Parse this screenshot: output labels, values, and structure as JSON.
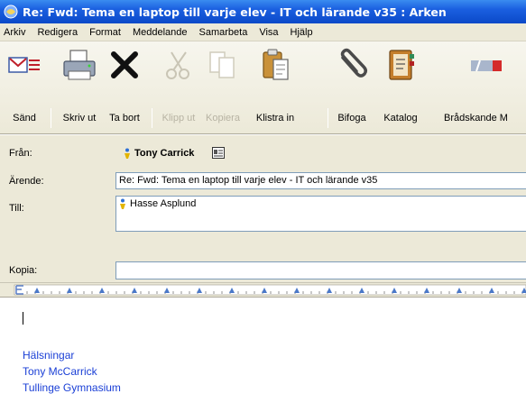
{
  "window": {
    "title": "Re: Fwd: Tema en laptop till varje elev -  IT och lärande v35 : Arken"
  },
  "menu": [
    "Arkiv",
    "Redigera",
    "Format",
    "Meddelande",
    "Samarbeta",
    "Visa",
    "Hjälp"
  ],
  "toolbar": {
    "send": "Sänd",
    "print": "Skriv ut",
    "delete": "Ta bort",
    "cut": "Klipp ut",
    "copy": "Kopiera",
    "paste": "Klistra in",
    "attach": "Bifoga",
    "catalog": "Katalog",
    "urgent": "Brådskande M"
  },
  "header": {
    "from_label": "Från:",
    "from_value": "Tony Carrick",
    "subject_label": "Ärende:",
    "subject_value": "Re: Fwd: Tema en laptop till varje elev -  IT och lärande v35",
    "to_label": "Till:",
    "to_value": "Hasse Asplund",
    "cc_label": "Kopia:",
    "cc_value": ""
  },
  "body": {
    "signature": [
      "Hälsningar",
      "Tony McCarrick",
      "Tullinge Gymnasium"
    ]
  },
  "colors": {
    "title_bar": "#0b49c8",
    "signature": "#1a3fd6",
    "chrome": "#ece9d8"
  }
}
